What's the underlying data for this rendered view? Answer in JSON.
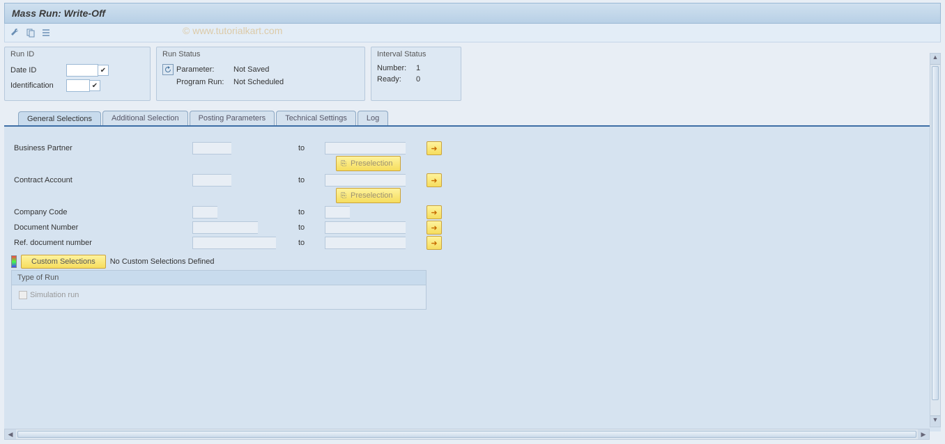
{
  "title": "Mass Run: Write-Off",
  "watermark": "© www.tutorialkart.com",
  "panels": {
    "runid": {
      "header": "Run ID",
      "date_id_label": "Date ID",
      "ident_label": "Identification"
    },
    "runstatus": {
      "header": "Run Status",
      "param_label": "Parameter:",
      "param_value": "Not Saved",
      "prog_label": "Program Run:",
      "prog_value": "Not Scheduled"
    },
    "interval": {
      "header": "Interval Status",
      "number_label": "Number:",
      "number_value": "1",
      "ready_label": "Ready:",
      "ready_value": "0"
    }
  },
  "tabs": [
    "General Selections",
    "Additional Selection",
    "Posting Parameters",
    "Technical Settings",
    "Log"
  ],
  "fields": {
    "bp": "Business Partner",
    "ca": "Contract Account",
    "cc": "Company Code",
    "dn": "Document Number",
    "rdn": "Ref. document number",
    "to": "to",
    "preselection": "Preselection"
  },
  "custom": {
    "button": "Custom Selections",
    "status": "No Custom Selections Defined"
  },
  "typebox": {
    "header": "Type of Run",
    "sim": "Simulation run"
  }
}
